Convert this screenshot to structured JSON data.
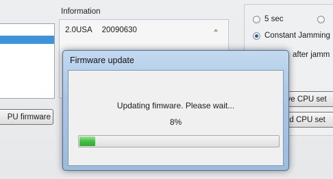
{
  "main_window": {
    "cpu_firmware_button": "PU firmware",
    "information": {
      "label": "Information",
      "version": "2.0USA",
      "date": "20090630"
    },
    "options": {
      "radio_5sec": {
        "label": "5 sec",
        "checked": false
      },
      "radio_constant_jamming": {
        "label": "Constant Jamming",
        "checked": true
      },
      "after_jamming_label": "after jamm",
      "save_cpu_button": "ive CPU set",
      "load_cpu_button": "ad CPU set"
    }
  },
  "dialog": {
    "title": "Firmware update",
    "message": "Updating fimware. Please wait...",
    "percent_text": "8%",
    "progress": 0.08,
    "progress_color": "#41c041"
  }
}
